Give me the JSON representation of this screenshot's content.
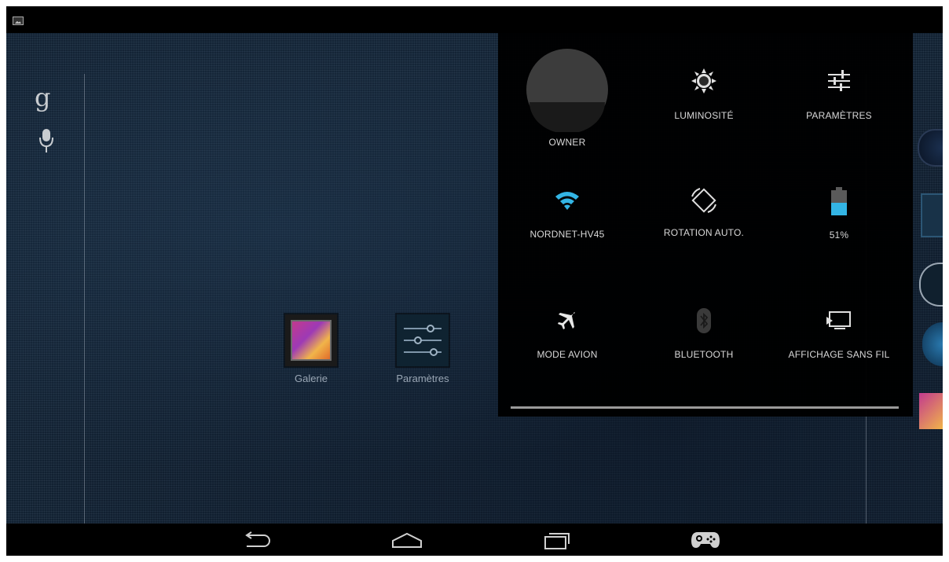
{
  "home": {
    "google_letter": "g",
    "apps": [
      {
        "label": "Galerie"
      },
      {
        "label": "Paramètres"
      }
    ]
  },
  "quick_settings": {
    "user": {
      "label": "OWNER"
    },
    "brightness": {
      "label": "LUMINOSITÉ"
    },
    "settings": {
      "label": "PARAMÈTRES"
    },
    "wifi": {
      "label": "NORDNET-HV45"
    },
    "rotation": {
      "label": "ROTATION AUTO."
    },
    "battery": {
      "label": "51%",
      "level": 0.51
    },
    "airplane": {
      "label": "MODE AVION"
    },
    "bluetooth": {
      "label": "BLUETOOTH"
    },
    "cast": {
      "label": "AFFICHAGE SANS FIL"
    }
  },
  "colors": {
    "accent": "#33b5e5",
    "panel_bg": "#000000",
    "label_text": "#d8d8d8"
  },
  "icons": {
    "status": "image-icon",
    "nav": [
      "back-icon",
      "home-icon",
      "recents-icon",
      "gamepad-icon"
    ]
  }
}
